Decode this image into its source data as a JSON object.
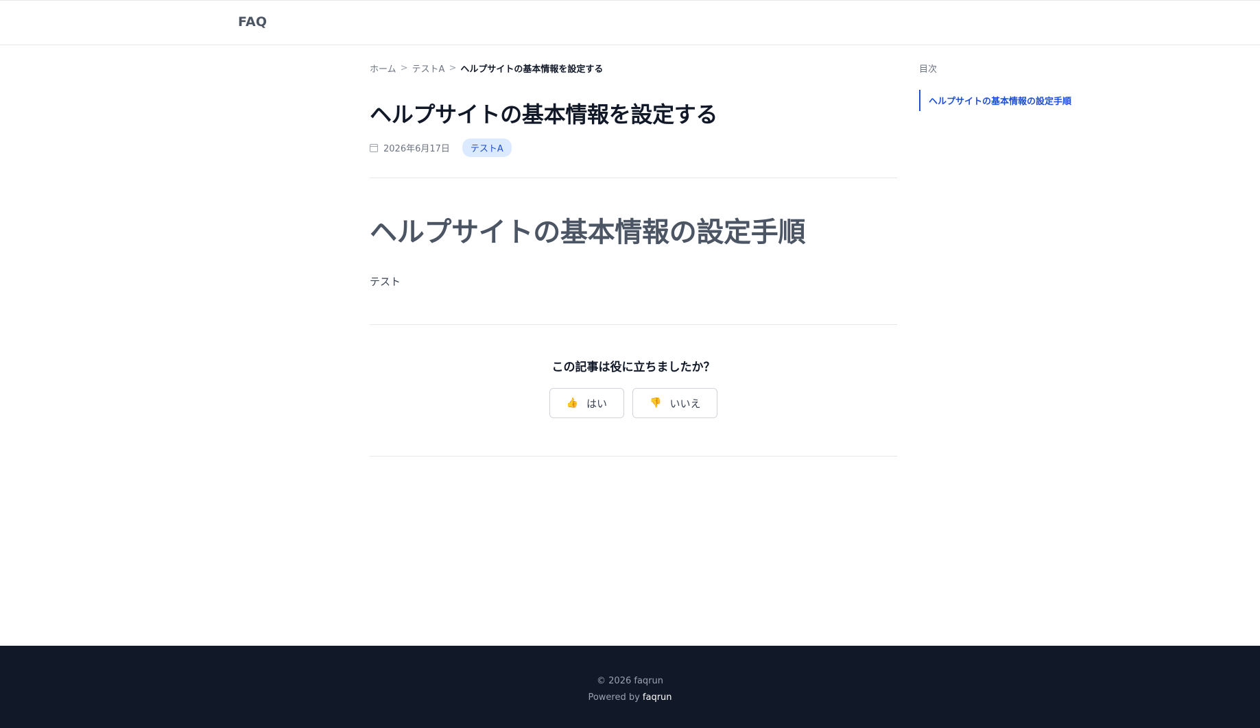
{
  "header": {
    "logo": "FAQ"
  },
  "breadcrumb": {
    "home": "ホーム",
    "separator": ">",
    "category": "テストA",
    "current": "ヘルプサイトの基本情報を設定する"
  },
  "article": {
    "title": "ヘルプサイトの基本情報を設定する",
    "date": "2026年6月17日",
    "tag": "テストA",
    "section_heading": "ヘルプサイトの基本情報の設定手順",
    "body": "テスト"
  },
  "feedback": {
    "question": "この記事は役に立ちましたか？",
    "yes_icon": "👍",
    "yes_label": "はい",
    "no_icon": "👎",
    "no_label": "いいえ"
  },
  "toc": {
    "title": "目次",
    "items": [
      {
        "label": "ヘルプサイトの基本情報の設定手順"
      }
    ]
  },
  "footer": {
    "copyright": "© 2026 faqrun",
    "powered_prefix": "Powered by",
    "powered_link": "faqrun"
  },
  "colors": {
    "accent": "#1d4ed8",
    "tag_bg": "#dbeafe",
    "footer_bg": "#111827"
  }
}
